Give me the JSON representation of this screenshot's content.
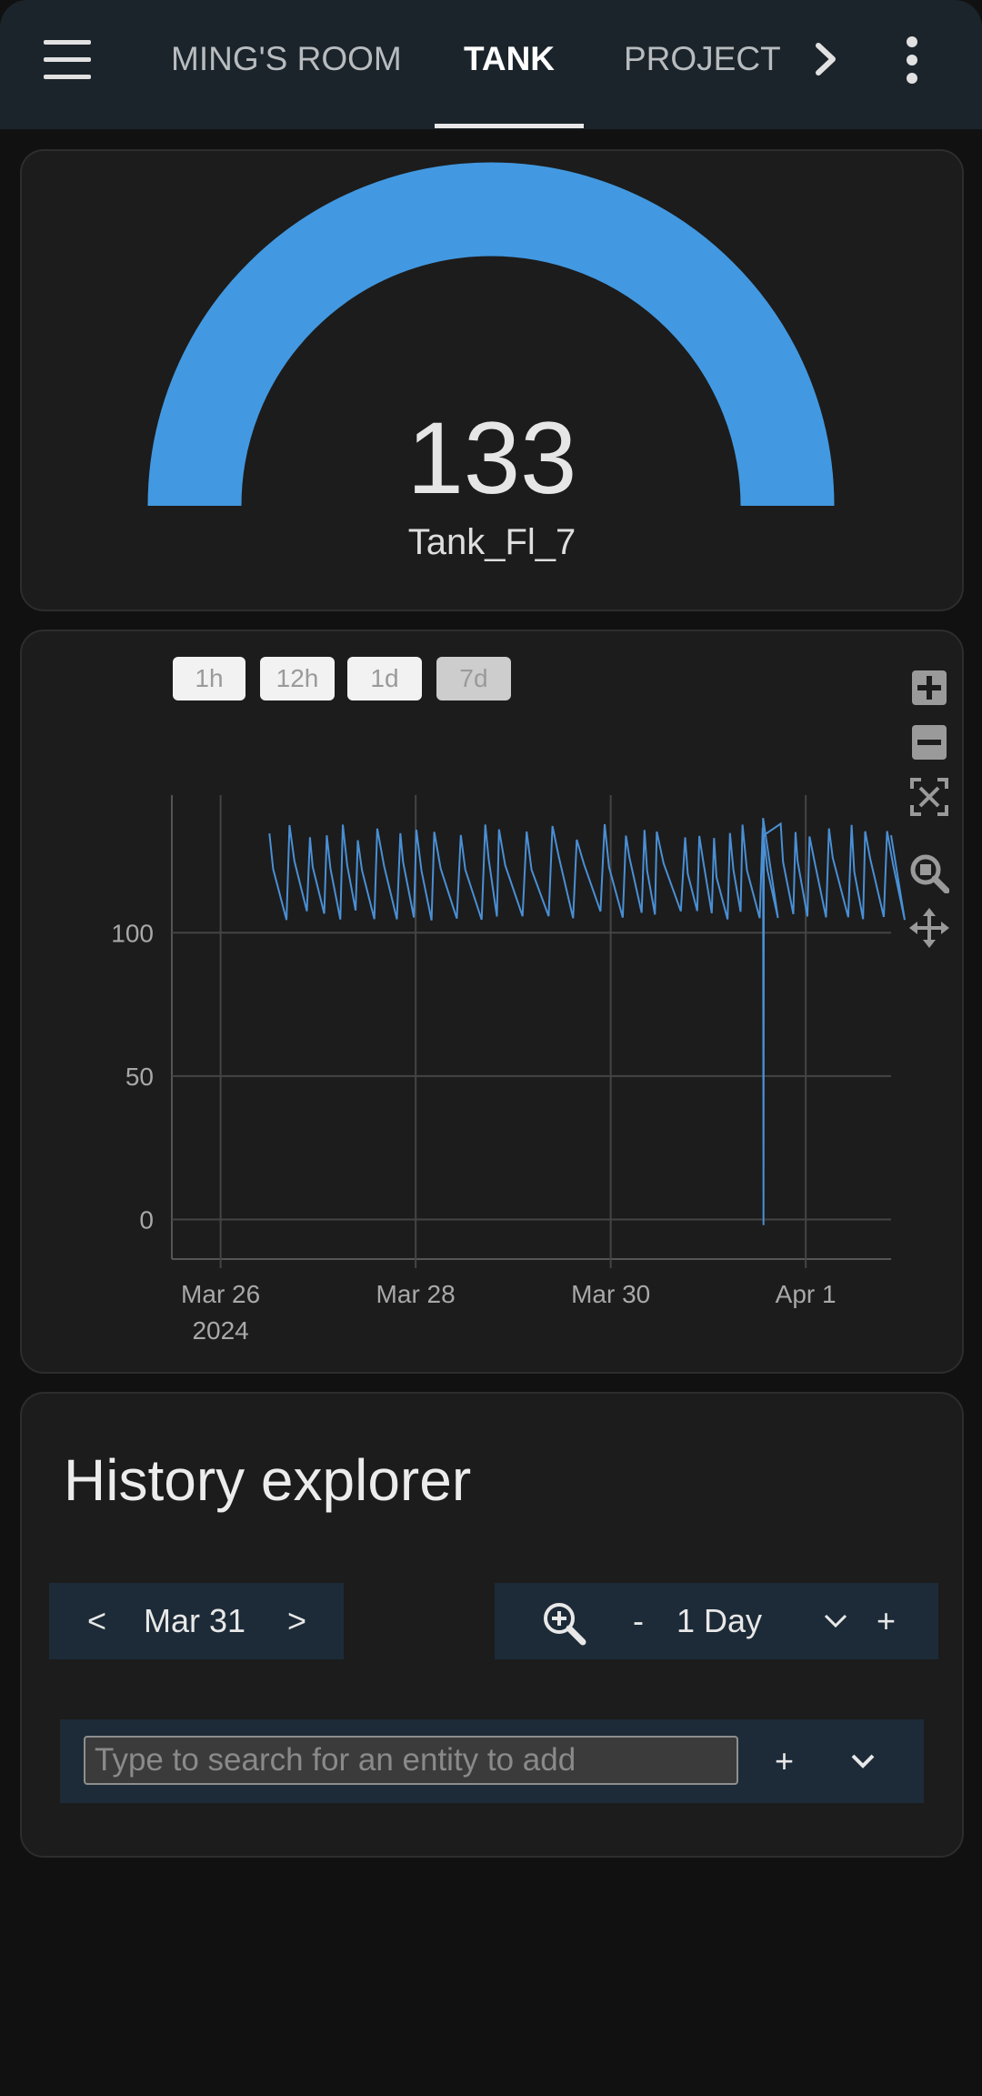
{
  "header": {
    "tabs": [
      {
        "label": "MING'S ROOM",
        "active": false
      },
      {
        "label": "TANK",
        "active": true
      },
      {
        "label": "PROJECT",
        "active": false
      }
    ],
    "menu_icon": "hamburger-menu-icon",
    "more_tabs_icon": "chevron-right-icon",
    "overflow_icon": "vertical-dots-icon"
  },
  "gauge": {
    "value": "133",
    "name": "Tank_Fl_7",
    "fraction": 1.0,
    "color": "#4299e1"
  },
  "history_chart": {
    "range_buttons": [
      "1h",
      "12h",
      "1d",
      "7d"
    ],
    "selected_range": "7d",
    "tools": [
      "zoom-in-icon",
      "zoom-out-icon",
      "autoscale-icon",
      "zoom-box-icon",
      "pan-icon"
    ],
    "line_color": "#4a8fd4"
  },
  "chart_data": {
    "type": "line",
    "x_axis": "time",
    "x_ticks": [
      "Mar 26",
      "Mar 28",
      "Mar 30",
      "Apr 1"
    ],
    "x_tick_year": "2024",
    "y_ticks": [
      "0",
      "50",
      "100"
    ],
    "ylim": [
      -10,
      148
    ],
    "xlim": [
      "2024-03-25T12:00",
      "2024-04-01T21:00"
    ],
    "grid": true,
    "series": [
      {
        "start": "2024-03-26T12:00",
        "end": "2024-04-01T21:00",
        "min": 104,
        "max": 138,
        "pattern": "sawtooth",
        "dip": {
          "time": "2024-03-31T13:30",
          "value": -2
        },
        "spike": {
          "time": "2024-03-31T13:30",
          "value": 140
        }
      }
    ]
  },
  "explorer": {
    "title": "History explorer",
    "prev_label": "<",
    "date_label": "Mar 31",
    "next_label": ">",
    "zoom_icon": "zoom-in-icon",
    "minus_label": "-",
    "period_label": "1 Day",
    "period_icon": "chevron-down-icon",
    "plus_label": "+",
    "search_placeholder": "Type to search for an entity to add",
    "add_label": "+",
    "expand_icon": "chevron-down-icon"
  }
}
